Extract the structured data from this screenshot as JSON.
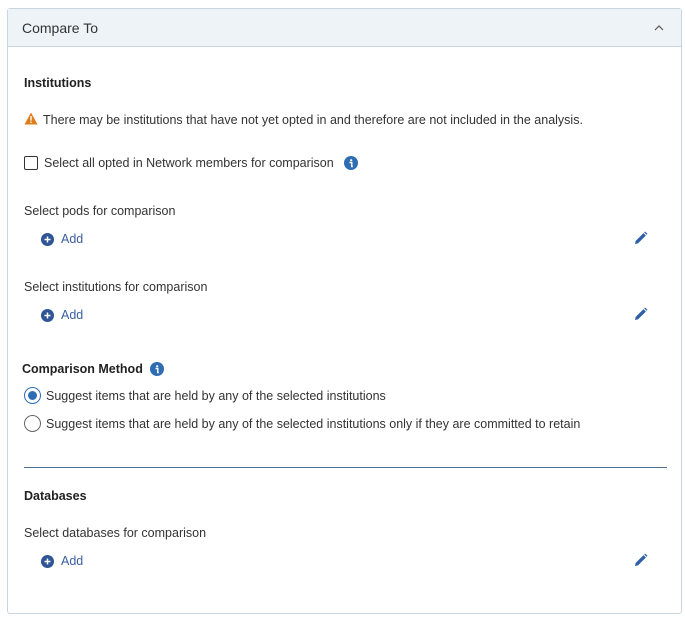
{
  "panel": {
    "title": "Compare To"
  },
  "institutions": {
    "heading": "Institutions",
    "warning": "There may be institutions that have not yet opted in and therefore are not included in the analysis.",
    "select_all_label": "Select all opted in Network members for comparison",
    "select_all_checked": false
  },
  "pods": {
    "label": "Select pods for comparison",
    "add_label": "Add"
  },
  "institutions_select": {
    "label": "Select institutions for comparison",
    "add_label": "Add"
  },
  "comparison_method": {
    "heading": "Comparison Method",
    "options": [
      {
        "label": "Suggest items that are held by any of the selected institutions",
        "checked": true
      },
      {
        "label": "Suggest items that are held by any of the selected institutions only if they are committed to retain",
        "checked": false
      }
    ]
  },
  "databases": {
    "heading": "Databases",
    "label": "Select databases for comparison",
    "add_label": "Add"
  },
  "colors": {
    "accent": "#2f6db3",
    "link": "#3a5f9e",
    "warning": "#e07b1a",
    "header_bg": "#eef3f7"
  }
}
